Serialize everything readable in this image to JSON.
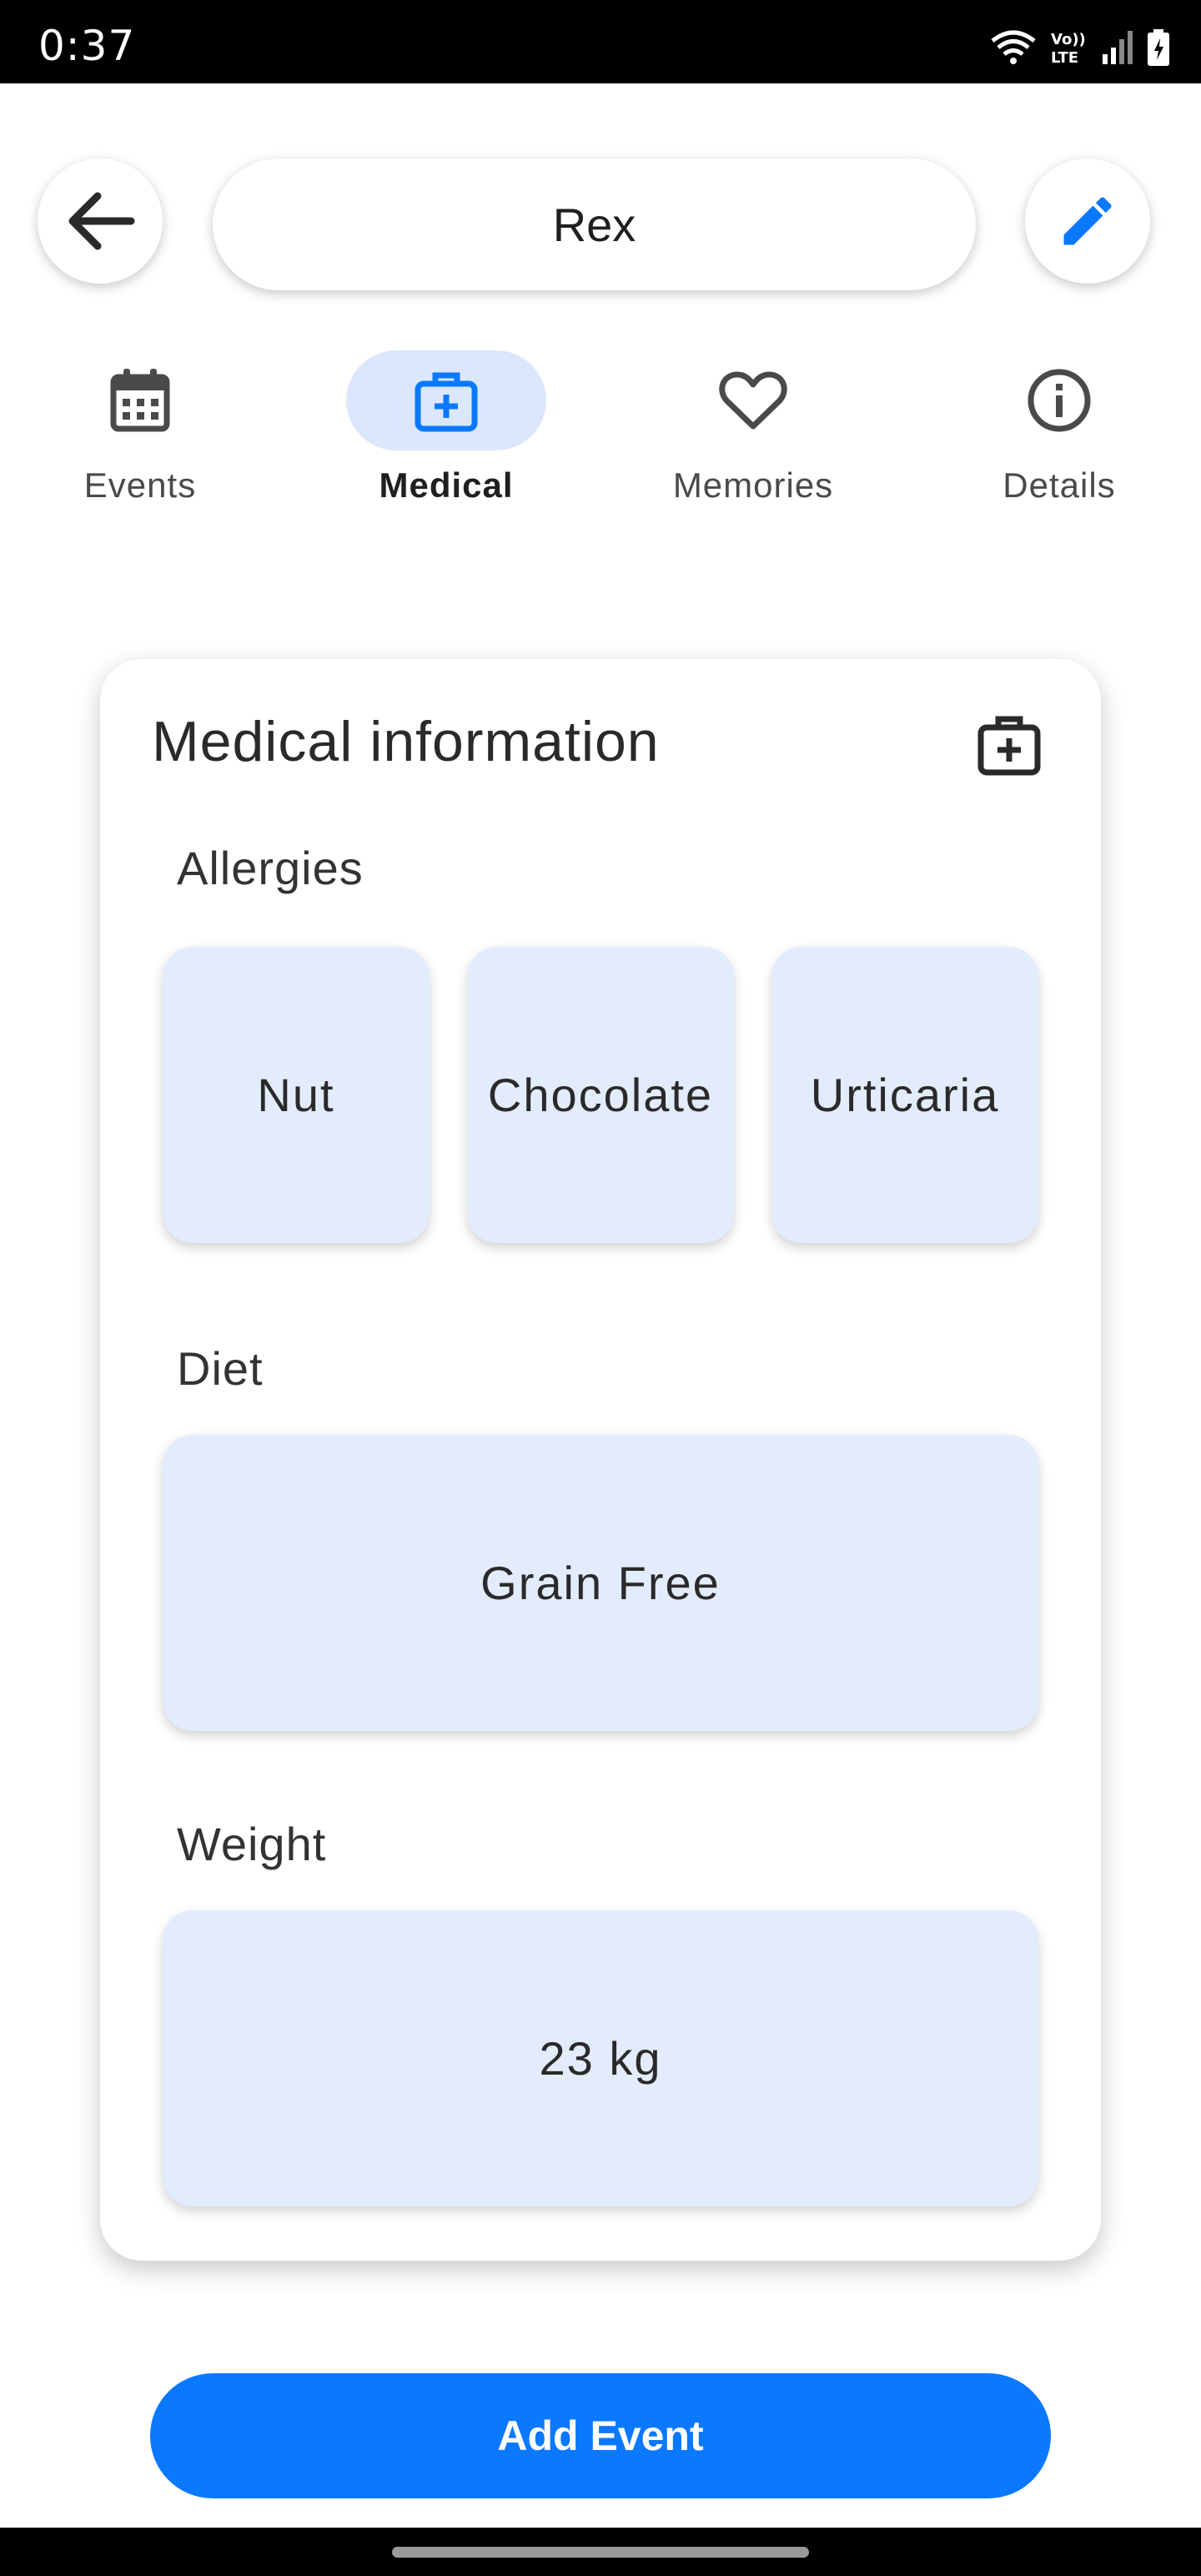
{
  "status_bar": {
    "time": "0:37"
  },
  "header": {
    "pet_name": "Rex"
  },
  "tabs": [
    {
      "label": "Events",
      "icon": "calendar-icon",
      "active": false
    },
    {
      "label": "Medical",
      "icon": "medical-bag-icon",
      "active": true
    },
    {
      "label": "Memories",
      "icon": "heart-icon",
      "active": false
    },
    {
      "label": "Details",
      "icon": "info-icon",
      "active": false
    }
  ],
  "medical": {
    "title": "Medical information",
    "allergies_label": "Allergies",
    "allergies": [
      "Nut",
      "Chocolate",
      "Urticaria"
    ],
    "diet_label": "Diet",
    "diet": "Grain Free",
    "weight_label": "Weight",
    "weight": "23 kg"
  },
  "actions": {
    "add_event": "Add Event"
  },
  "colors": {
    "accent": "#0a78ff",
    "chip_bg": "#e2ecfc",
    "active_tab_bg": "#dde7fb"
  }
}
